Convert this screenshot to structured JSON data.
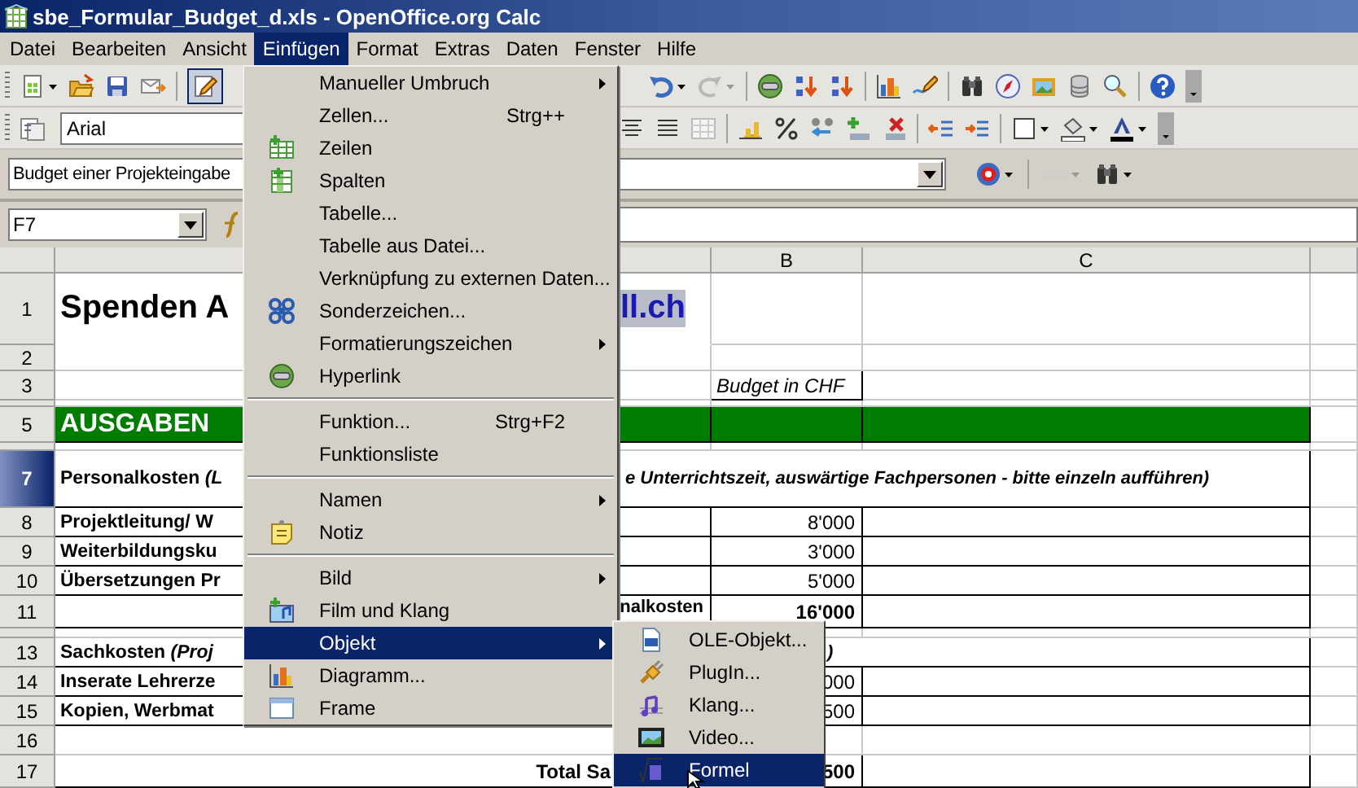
{
  "window": {
    "title": "sbe_Formular_Budget_d.xls - OpenOffice.org Calc"
  },
  "menubar": [
    {
      "label": "Datei",
      "selected": false
    },
    {
      "label": "Bearbeiten",
      "selected": false
    },
    {
      "label": "Ansicht",
      "selected": false
    },
    {
      "label": "Einfügen",
      "selected": true
    },
    {
      "label": "Format",
      "selected": false
    },
    {
      "label": "Extras",
      "selected": false
    },
    {
      "label": "Daten",
      "selected": false
    },
    {
      "label": "Fenster",
      "selected": false
    },
    {
      "label": "Hilfe",
      "selected": false
    }
  ],
  "toolbars": {
    "font_name": "Arial",
    "area_field": "Budget einer Projekteingabe",
    "name_box": "F7"
  },
  "sheet": {
    "columns": [
      {
        "label": "B"
      },
      {
        "label": "C"
      }
    ],
    "rows": [
      {
        "number": "1",
        "selected": false,
        "kind": "title",
        "a": "Spenden A",
        "a_tail": "ll.ch"
      },
      {
        "number": "2",
        "selected": false,
        "kind": "blank"
      },
      {
        "number": "3",
        "selected": false,
        "kind": "blank",
        "b": "Budget in CHF"
      },
      {
        "selected": false,
        "kind": "blank"
      },
      {
        "number": "5",
        "selected": false,
        "kind": "section",
        "a": "AUSGABEN"
      },
      {
        "selected": false,
        "kind": "blank"
      },
      {
        "number": "7",
        "selected": true,
        "kind": "heading",
        "a": "Personalkosten *(L*",
        "a_tail": "e Unterrichtszeit, auswärtige Fachpersonen - bitte einzeln aufführen)"
      },
      {
        "number": "8",
        "selected": false,
        "kind": "item",
        "a": "Projektleitung/ W",
        "b": "8'000"
      },
      {
        "number": "9",
        "selected": false,
        "kind": "item",
        "a": "Weiterbildungsku",
        "b": "3'000"
      },
      {
        "number": "10",
        "selected": false,
        "kind": "item",
        "a": "Übersetzungen Pr",
        "b": "5'000"
      },
      {
        "number": "11",
        "selected": false,
        "kind": "total",
        "a_tail": "nalkosten",
        "b": "16'000"
      },
      {
        "selected": false,
        "kind": "blank"
      },
      {
        "number": "13",
        "selected": false,
        "kind": "heading",
        "a": "Sachkosten *(Proj*",
        "a_tail": ".)"
      },
      {
        "number": "14",
        "selected": false,
        "kind": "item",
        "a": "Inserate Lehrerze",
        "b": "000"
      },
      {
        "number": "15",
        "selected": false,
        "kind": "item",
        "a": "Kopien, Werbmat",
        "b": "500"
      },
      {
        "number": "16",
        "selected": false,
        "kind": "blank"
      },
      {
        "number": "17",
        "selected": false,
        "kind": "total",
        "a_tail": "Total Sa",
        "b": "500"
      }
    ]
  },
  "menu": {
    "groups": [
      [
        {
          "label": "Manueller Umbruch",
          "submenu": true,
          "selected": false
        },
        {
          "label": "Zellen...",
          "shortcut": "Strg++",
          "submenu": false,
          "selected": false
        },
        {
          "label": "Zeilen",
          "submenu": false,
          "selected": false
        },
        {
          "label": "Spalten",
          "submenu": false,
          "selected": false
        },
        {
          "label": "Tabelle...",
          "submenu": false,
          "selected": false
        },
        {
          "label": "Tabelle aus Datei...",
          "submenu": false,
          "selected": false
        },
        {
          "label": "Verknüpfung zu externen Daten...",
          "submenu": false,
          "selected": false
        },
        {
          "label": "Sonderzeichen...",
          "submenu": false,
          "selected": false
        },
        {
          "label": "Formatierungszeichen",
          "submenu": true,
          "selected": false
        },
        {
          "label": "Hyperlink",
          "submenu": false,
          "selected": false
        }
      ],
      [
        {
          "label": "Funktion...",
          "shortcut": "Strg+F2",
          "submenu": false,
          "selected": false
        },
        {
          "label": "Funktionsliste",
          "submenu": false,
          "selected": false
        }
      ],
      [
        {
          "label": "Namen",
          "submenu": true,
          "selected": false
        },
        {
          "label": "Notiz",
          "submenu": false,
          "selected": false
        }
      ],
      [
        {
          "label": "Bild",
          "submenu": true,
          "selected": false
        },
        {
          "label": "Film und Klang",
          "submenu": false,
          "selected": false
        },
        {
          "label": "Objekt",
          "submenu": true,
          "selected": true
        },
        {
          "label": "Diagramm...",
          "submenu": false,
          "selected": false
        },
        {
          "label": "Frame",
          "submenu": false,
          "selected": false
        }
      ]
    ]
  },
  "submenu": {
    "items": [
      {
        "label": "OLE-Objekt...",
        "selected": false
      },
      {
        "label": "PlugIn...",
        "selected": false
      },
      {
        "label": "Klang...",
        "selected": false
      },
      {
        "label": "Video...",
        "selected": false
      },
      {
        "label": "Formel",
        "selected": true
      }
    ]
  }
}
